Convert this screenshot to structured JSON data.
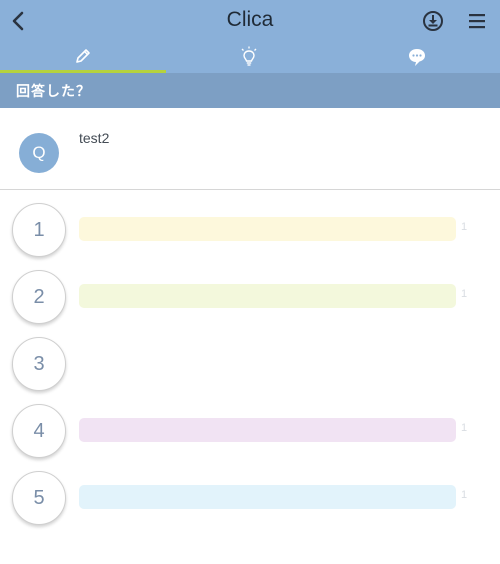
{
  "app": {
    "title": "Clica"
  },
  "header": {
    "back_icon": "chevron-left-icon",
    "download_icon": "download-circle-icon",
    "menu_icon": "hamburger-menu-icon"
  },
  "tabs": [
    {
      "name": "answer",
      "icon": "pencil-icon",
      "active": true
    },
    {
      "name": "idea",
      "icon": "lightbulb-icon",
      "active": false
    },
    {
      "name": "comment",
      "icon": "speech-bubble-icon",
      "active": false
    }
  ],
  "section": {
    "title": "回答した？"
  },
  "question": {
    "badge": "Q",
    "text": "test2"
  },
  "options": [
    {
      "number": "1",
      "count": "1",
      "color": "#fdf8dc",
      "show_bar": true
    },
    {
      "number": "2",
      "count": "1",
      "color": "#f3f8dc",
      "show_bar": true
    },
    {
      "number": "3",
      "count": "",
      "color": "",
      "show_bar": false
    },
    {
      "number": "4",
      "count": "1",
      "color": "#f1e3f3",
      "show_bar": true
    },
    {
      "number": "5",
      "count": "1",
      "color": "#e2f3fb",
      "show_bar": true
    }
  ],
  "colors": {
    "header_bg": "#8ab0d9",
    "section_bg": "#7d9fc4",
    "active_tab_underline": "#b6d23d",
    "badge_bg": "#86aed6"
  }
}
